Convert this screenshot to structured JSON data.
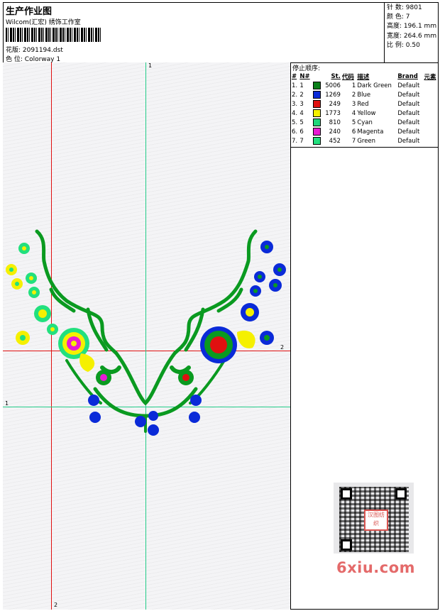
{
  "header": {
    "title": "生产作业图",
    "company": "Wilcom(汇宏) 绣饰工作室",
    "design_label": "花版:",
    "design_value": "2091194.dst",
    "colorway_label": "色 位:",
    "colorway_value": "Colorway 1"
  },
  "stats": {
    "stitches_label": "针 数:",
    "stitches_value": "9801",
    "colors_label": "颜 色:",
    "colors_value": "7",
    "height_label": "高度:",
    "height_value": "196.1 mm",
    "width_label": "宽度:",
    "width_value": "264.6 mm",
    "scale_label": "比 例:",
    "scale_value": "0.50"
  },
  "stop_sequence": {
    "title": "停止顺序:",
    "headers": {
      "hash": "#",
      "n": "N#",
      "st": "St.",
      "code": "代码",
      "desc": "描述",
      "brand": "Brand",
      "element": "元素"
    },
    "rows": [
      {
        "hash": "1.",
        "n": "1",
        "color": "#0a7f1a",
        "st": "5006",
        "code": "1",
        "desc": "Dark Green",
        "brand": "Default"
      },
      {
        "hash": "2.",
        "n": "2",
        "color": "#0a2ad8",
        "st": "1269",
        "code": "2",
        "desc": "Blue",
        "brand": "Default"
      },
      {
        "hash": "3.",
        "n": "3",
        "color": "#e01010",
        "st": "249",
        "code": "3",
        "desc": "Red",
        "brand": "Default"
      },
      {
        "hash": "4.",
        "n": "4",
        "color": "#f5f000",
        "st": "1773",
        "code": "4",
        "desc": "Yellow",
        "brand": "Default"
      },
      {
        "hash": "5.",
        "n": "5",
        "color": "#1fd67a",
        "st": "810",
        "code": "5",
        "desc": "Cyan",
        "brand": "Default"
      },
      {
        "hash": "6.",
        "n": "6",
        "color": "#e81ad4",
        "st": "240",
        "code": "6",
        "desc": "Magenta",
        "brand": "Default"
      },
      {
        "hash": "7.",
        "n": "7",
        "color": "#22e07e",
        "st": "452",
        "code": "7",
        "desc": "Green",
        "brand": "Default"
      }
    ]
  },
  "guides": {
    "label_1": "1",
    "label_2": "2",
    "red_color": "#e01010",
    "green_color": "#22cc88"
  },
  "watermark": {
    "stamp_text": "汉图纺织",
    "site": "6xiu.com"
  }
}
